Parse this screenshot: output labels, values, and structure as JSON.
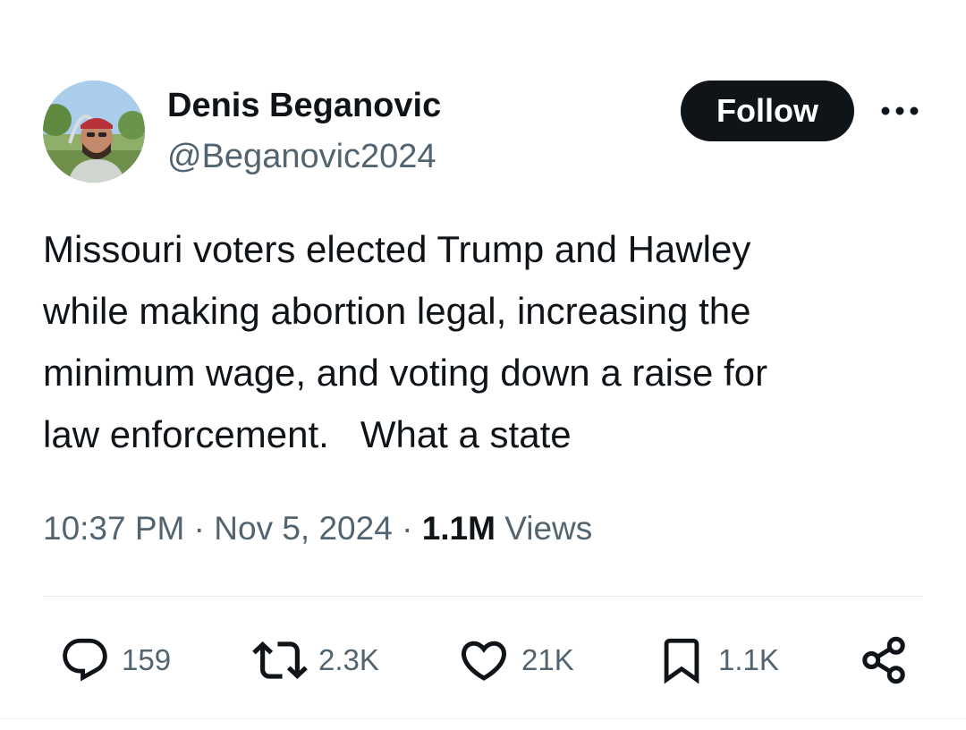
{
  "author": {
    "display_name": "Denis Beganovic",
    "handle": "@Beganovic2024",
    "avatar_icon": "profile-photo"
  },
  "header": {
    "follow_label": "Follow",
    "more_icon": "more-horizontal-icon"
  },
  "tweet": {
    "lines": [
      "Missouri voters elected Trump and Hawley",
      "while making abortion legal, increasing the",
      "minimum wage, and voting down a raise for",
      "law enforcement.   What a state"
    ]
  },
  "meta": {
    "time": "10:37 PM",
    "separator": " · ",
    "date": "Nov 5, 2024",
    "views_count": "1.1M",
    "views_label": " Views"
  },
  "actions": {
    "replies": "159",
    "reposts": "2.3K",
    "likes": "21K",
    "bookmarks": "1.1K"
  },
  "colors": {
    "text": "#0f1419",
    "secondary": "#536471",
    "button_bg": "#0f1419",
    "divider": "#e6ebef"
  }
}
